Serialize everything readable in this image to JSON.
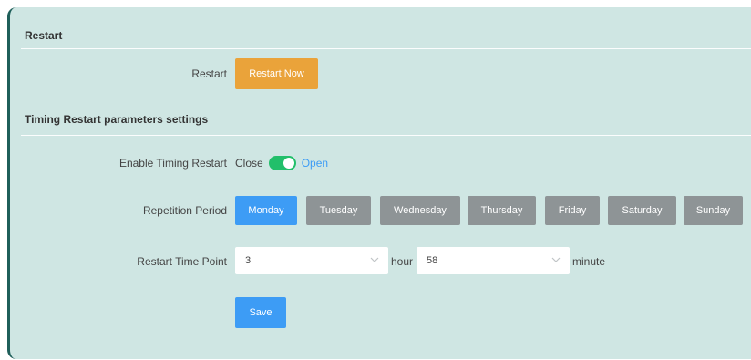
{
  "restart_section": {
    "title": "Restart",
    "label": "Restart",
    "button": "Restart Now"
  },
  "timing_section": {
    "title": "Timing Restart parameters settings",
    "enable": {
      "label": "Enable Timing Restart",
      "off_text": "Close",
      "on_text": "Open",
      "state": "on"
    },
    "repetition": {
      "label": "Repetition Period",
      "days": [
        {
          "label": "Monday",
          "selected": true
        },
        {
          "label": "Tuesday",
          "selected": false
        },
        {
          "label": "Wednesday",
          "selected": false
        },
        {
          "label": "Thursday",
          "selected": false
        },
        {
          "label": "Friday",
          "selected": false
        },
        {
          "label": "Saturday",
          "selected": false
        },
        {
          "label": "Sunday",
          "selected": false
        }
      ]
    },
    "time_point": {
      "label": "Restart Time Point",
      "hour_value": "3",
      "hour_unit": "hour",
      "minute_value": "58",
      "minute_unit": "minute"
    },
    "save_button": "Save"
  },
  "colors": {
    "accent_orange": "#eaa33a",
    "accent_blue": "#3d9cf5",
    "toggle_green": "#22bf6a",
    "inactive_gray": "#8e9496",
    "panel_bg": "#cfe6e3"
  }
}
